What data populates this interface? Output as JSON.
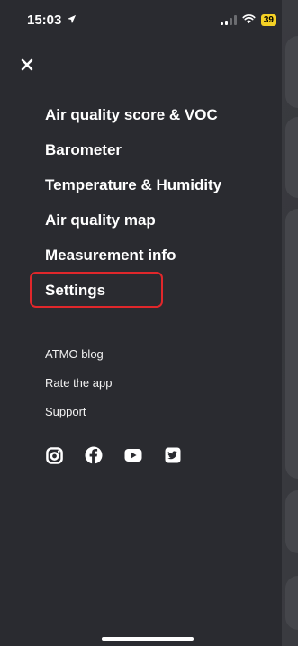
{
  "status": {
    "time": "15:03",
    "battery": "39"
  },
  "menu": {
    "items": [
      {
        "label": "Air quality score & VOC"
      },
      {
        "label": "Barometer"
      },
      {
        "label": "Temperature & Humidity"
      },
      {
        "label": "Air quality map"
      },
      {
        "label": "Measurement info"
      },
      {
        "label": "Settings"
      }
    ],
    "highlighted": "Settings",
    "highlight_color": "#e0272b"
  },
  "links": {
    "items": [
      {
        "label": "ATMO blog"
      },
      {
        "label": "Rate the app"
      },
      {
        "label": "Support"
      }
    ]
  },
  "social": {
    "icons": [
      "instagram-icon",
      "facebook-icon",
      "youtube-icon",
      "twitter-icon"
    ]
  },
  "colors": {
    "background": "#2a2b30",
    "text": "#ffffff",
    "battery": "#f5d125"
  }
}
